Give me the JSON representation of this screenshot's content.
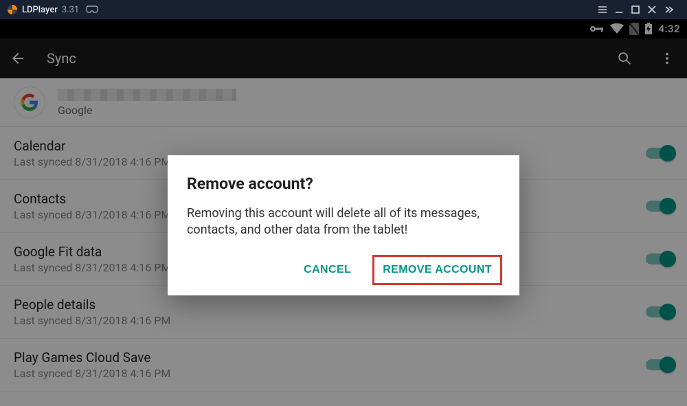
{
  "window": {
    "app_name": "LDPlayer",
    "app_version": "3.31"
  },
  "status": {
    "clock": "4:32"
  },
  "appbar": {
    "title": "Sync"
  },
  "account": {
    "provider": "Google"
  },
  "sync_items": [
    {
      "name": "Calendar",
      "sub": "Last synced 8/31/2018 4:16 PM"
    },
    {
      "name": "Contacts",
      "sub": "Last synced 8/31/2018 4:16 PM"
    },
    {
      "name": "Google Fit data",
      "sub": "Last synced 8/31/2018 4:16 PM"
    },
    {
      "name": "People details",
      "sub": "Last synced 8/31/2018 4:16 PM"
    },
    {
      "name": "Play Games Cloud Save",
      "sub": "Last synced 8/31/2018 4:16 PM"
    }
  ],
  "dialog": {
    "title": "Remove account?",
    "message": "Removing this account will delete all of its messages, contacts, and other data from the tablet!",
    "cancel": "CANCEL",
    "confirm": "REMOVE ACCOUNT"
  }
}
